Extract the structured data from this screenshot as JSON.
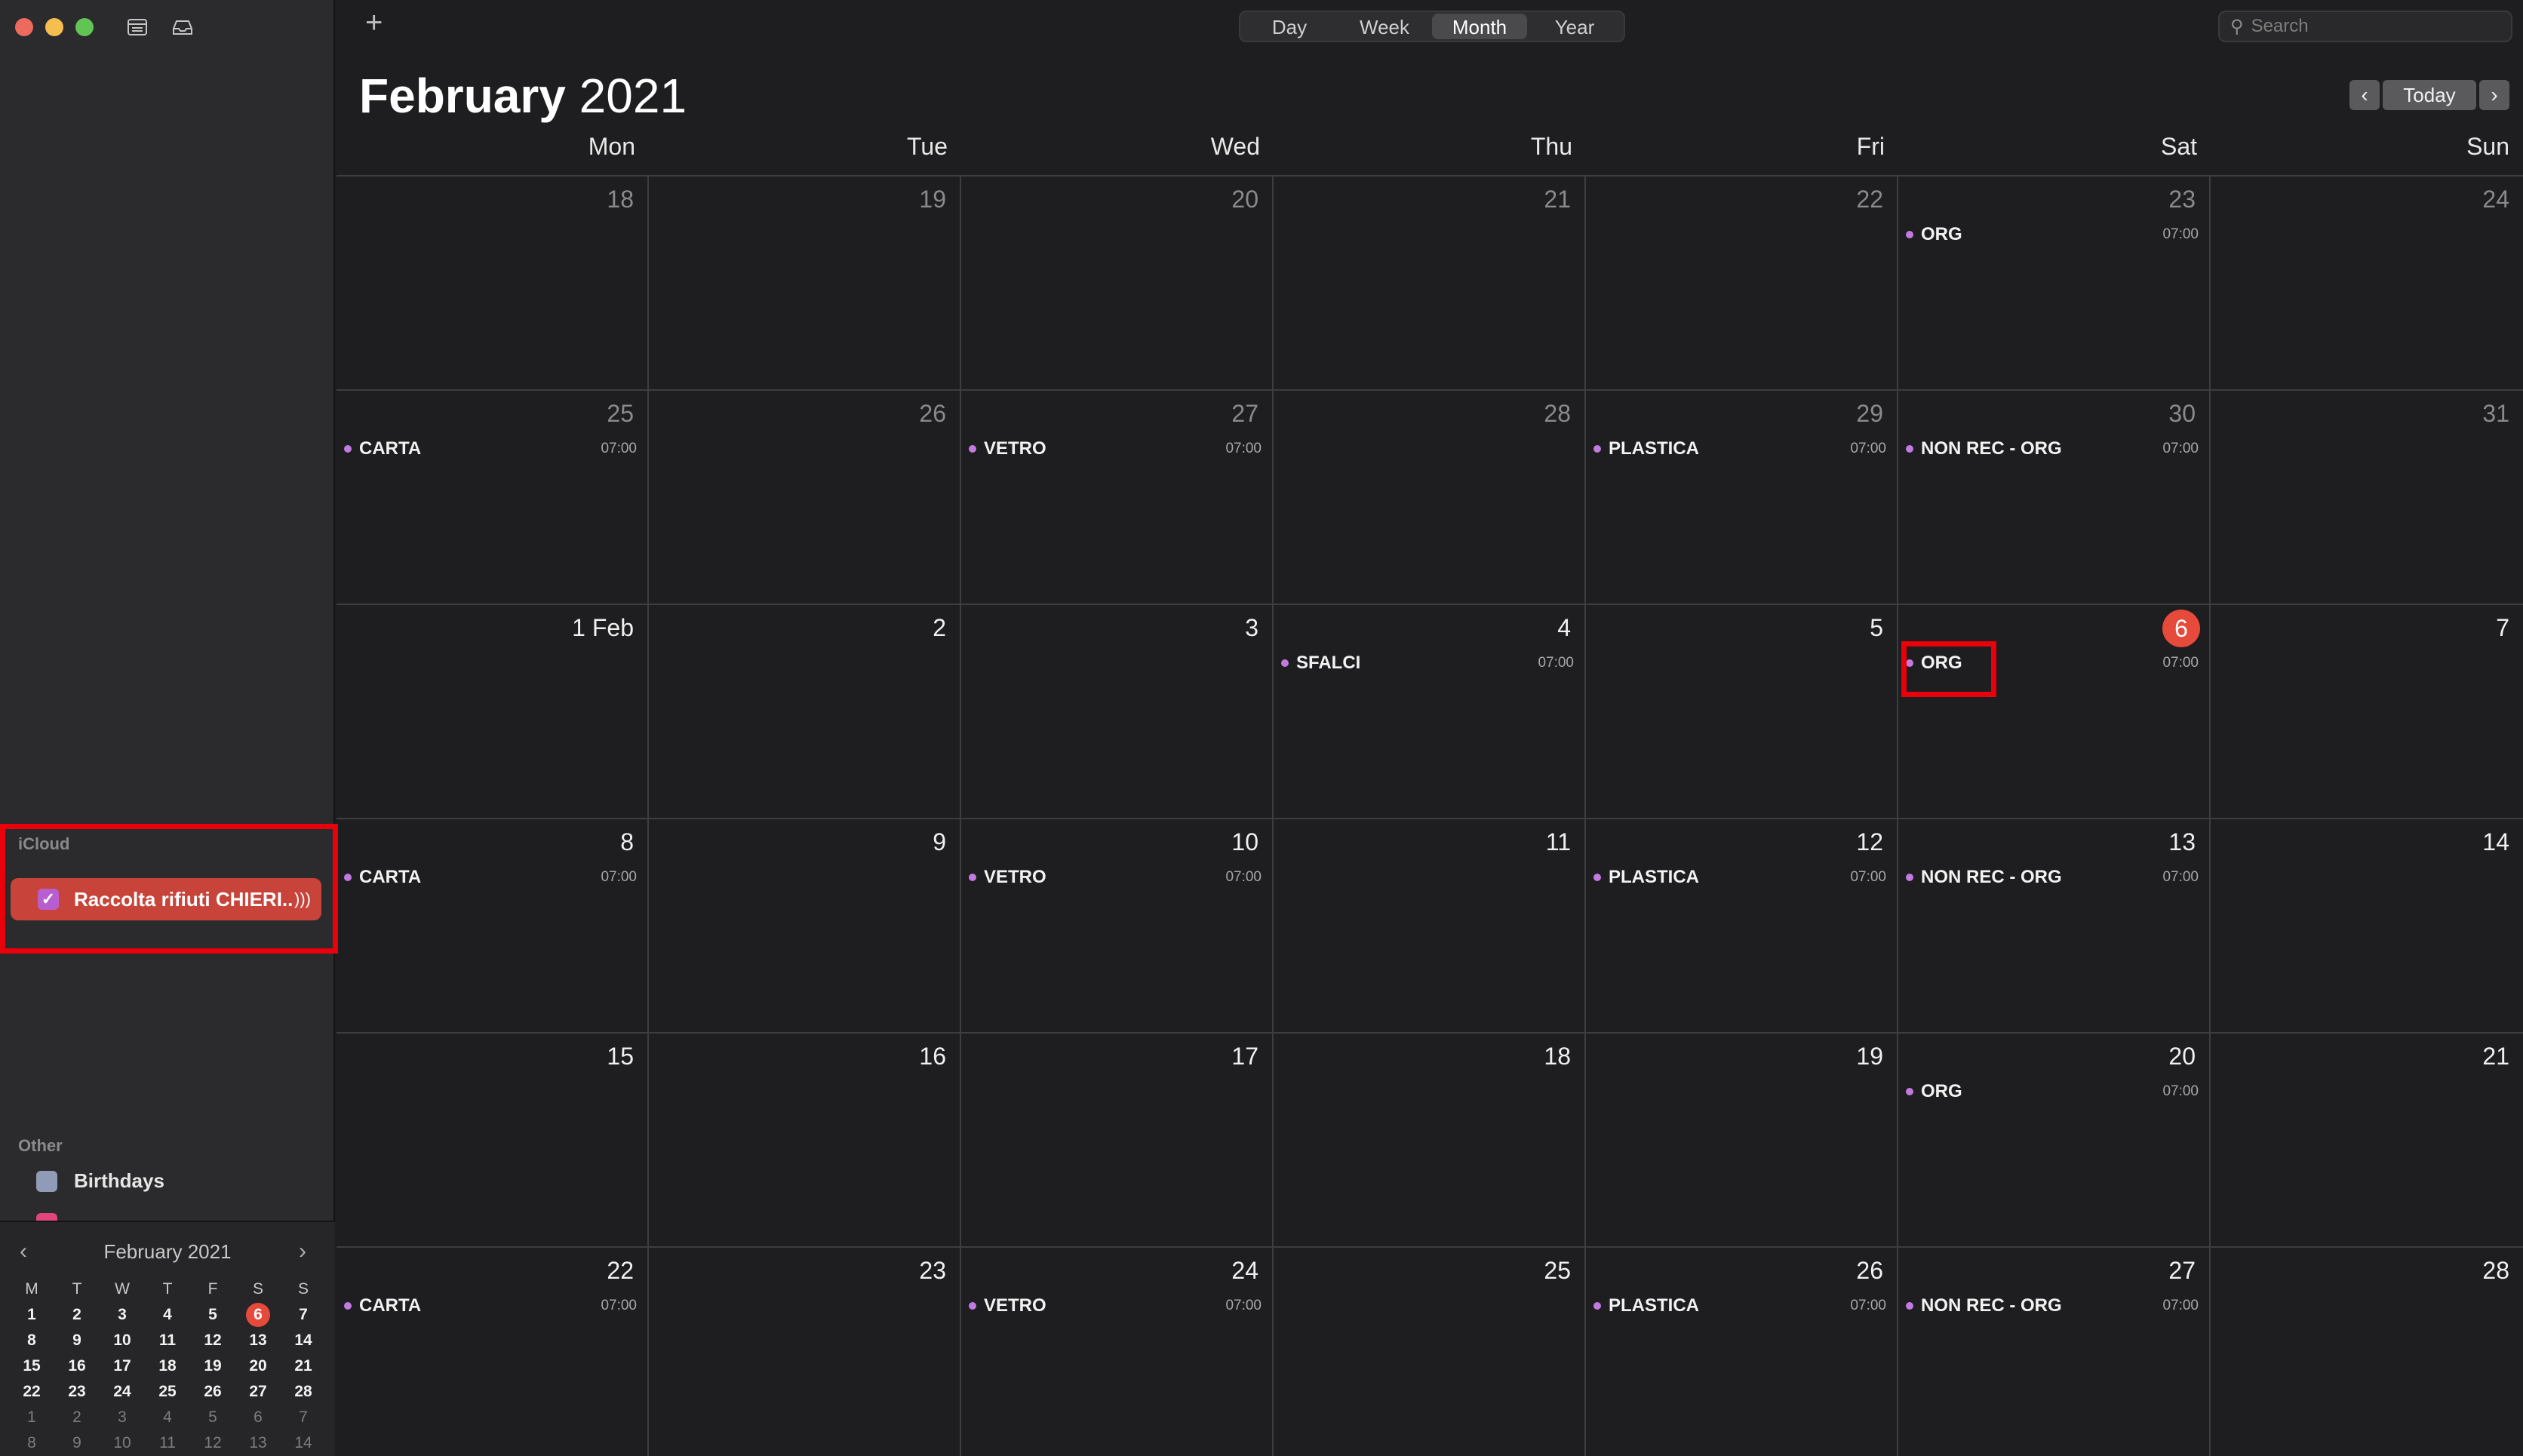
{
  "toolbar": {
    "add_symbol": "+",
    "views": [
      "Day",
      "Week",
      "Month",
      "Year"
    ],
    "active_view": "Month",
    "search_placeholder": "Search",
    "search_value": ""
  },
  "header": {
    "month": "February",
    "year": "2021",
    "today_label": "Today",
    "prev_symbol": "‹",
    "next_symbol": "›"
  },
  "weekdays": [
    "Mon",
    "Tue",
    "Wed",
    "Thu",
    "Fri",
    "Sat",
    "Sun"
  ],
  "days": [
    {
      "label": "18",
      "prev": true
    },
    {
      "label": "19",
      "prev": true
    },
    {
      "label": "20",
      "prev": true
    },
    {
      "label": "21",
      "prev": true
    },
    {
      "label": "22",
      "prev": true
    },
    {
      "label": "23",
      "prev": true,
      "event": "ORG",
      "time": "07:00"
    },
    {
      "label": "24",
      "prev": true
    },
    {
      "label": "25",
      "prev": true,
      "event": "CARTA",
      "time": "07:00"
    },
    {
      "label": "26",
      "prev": true
    },
    {
      "label": "27",
      "prev": true,
      "event": "VETRO",
      "time": "07:00"
    },
    {
      "label": "28",
      "prev": true
    },
    {
      "label": "29",
      "prev": true,
      "event": "PLASTICA",
      "time": "07:00"
    },
    {
      "label": "30",
      "prev": true,
      "event": "NON REC - ORG",
      "time": "07:00"
    },
    {
      "label": "31",
      "prev": true
    },
    {
      "label": "1 Feb"
    },
    {
      "label": "2"
    },
    {
      "label": "3"
    },
    {
      "label": "4",
      "event": "SFALCI",
      "time": "07:00"
    },
    {
      "label": "5"
    },
    {
      "label": "6",
      "today": true,
      "event": "ORG",
      "time": "07:00"
    },
    {
      "label": "7"
    },
    {
      "label": "8",
      "event": "CARTA",
      "time": "07:00"
    },
    {
      "label": "9"
    },
    {
      "label": "10",
      "event": "VETRO",
      "time": "07:00"
    },
    {
      "label": "11"
    },
    {
      "label": "12",
      "event": "PLASTICA",
      "time": "07:00"
    },
    {
      "label": "13",
      "event": "NON REC - ORG",
      "time": "07:00"
    },
    {
      "label": "14"
    },
    {
      "label": "15"
    },
    {
      "label": "16"
    },
    {
      "label": "17"
    },
    {
      "label": "18"
    },
    {
      "label": "19"
    },
    {
      "label": "20",
      "event": "ORG",
      "time": "07:00"
    },
    {
      "label": "21"
    },
    {
      "label": "22",
      "event": "CARTA",
      "time": "07:00"
    },
    {
      "label": "23"
    },
    {
      "label": "24",
      "event": "VETRO",
      "time": "07:00"
    },
    {
      "label": "25"
    },
    {
      "label": "26",
      "event": "PLASTICA",
      "time": "07:00"
    },
    {
      "label": "27",
      "event": "NON REC - ORG",
      "time": "07:00"
    },
    {
      "label": "28"
    }
  ],
  "sidebar": {
    "icloud_label": "iCloud",
    "calendar_name": "Raccolta rifiuti CHIERI...",
    "calendar_color": "#b85fd0",
    "other_label": "Other",
    "birthdays_label": "Birthdays"
  },
  "mini_calendar": {
    "title": "February 2021",
    "headers": [
      "M",
      "T",
      "W",
      "T",
      "F",
      "S",
      "S"
    ],
    "rows": [
      [
        "1",
        "2",
        "3",
        "4",
        "5",
        "6",
        "7"
      ],
      [
        "8",
        "9",
        "10",
        "11",
        "12",
        "13",
        "14"
      ],
      [
        "15",
        "16",
        "17",
        "18",
        "19",
        "20",
        "21"
      ],
      [
        "22",
        "23",
        "24",
        "25",
        "26",
        "27",
        "28"
      ],
      [
        "1",
        "2",
        "3",
        "4",
        "5",
        "6",
        "7"
      ],
      [
        "8",
        "9",
        "10",
        "11",
        "12",
        "13",
        "14"
      ]
    ],
    "today": "6"
  },
  "colors": {
    "accent_red": "#e64a3b",
    "event_dot": "#c27ae0",
    "highlight": "#e8000b"
  }
}
